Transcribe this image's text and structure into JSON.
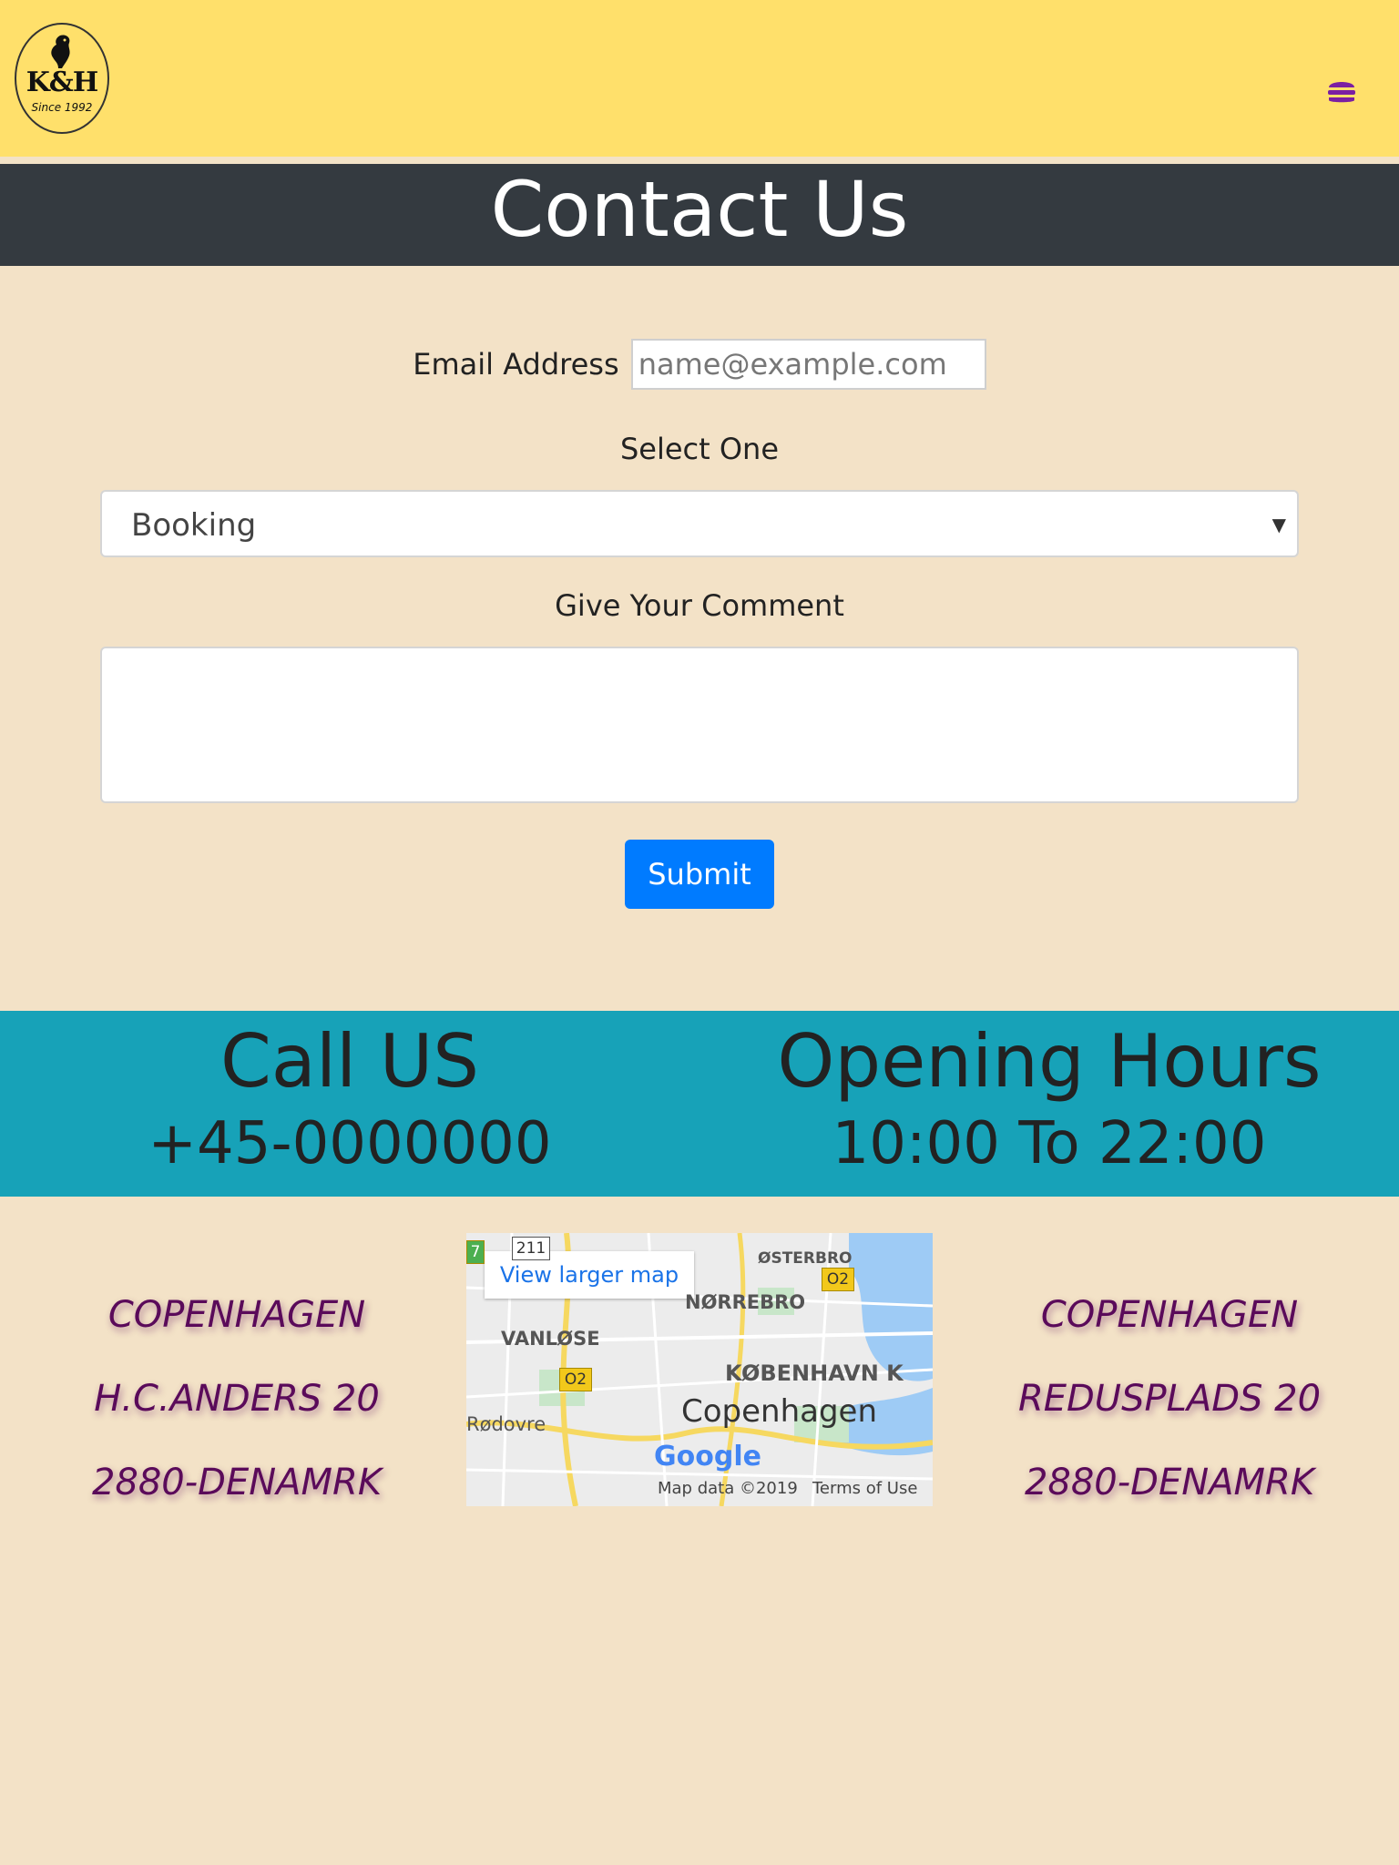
{
  "header": {
    "logo_text": "K&H",
    "logo_since": "Since 1992",
    "menu_icon": "burger-icon",
    "accent_color": "#ffe06b",
    "menu_icon_color": "#7b1fa2"
  },
  "page_title": "Contact Us",
  "form": {
    "email_label": "Email Address",
    "email_placeholder": "name@example.com",
    "select_label": "Select One",
    "select_value": "Booking",
    "comment_label": "Give Your Comment",
    "comment_value": "",
    "submit_label": "Submit",
    "submit_color": "#007bff"
  },
  "info": {
    "call_title": "Call US",
    "call_value": "+45-0000000",
    "hours_title": "Opening Hours",
    "hours_value": "10:00 To 22:00",
    "band_color": "#17a2b8"
  },
  "addresses": [
    {
      "city": "COPENHAGEN",
      "street": "H.C.ANDERS 20",
      "postal": "2880-DENAMRK"
    },
    {
      "city": "COPENHAGEN",
      "street": "REDUSPLADS 20",
      "postal": "2880-DENAMRK"
    }
  ],
  "map": {
    "view_larger": "View larger map",
    "labels": {
      "osterbro": "ØSTERBRO",
      "norrebro": "NØRREBRO",
      "vanlose": "VANLØSE",
      "kobenhavn": "KØBENHAVN K",
      "rodovre": "Rødovre",
      "city": "Copenhagen",
      "road_a": "O2",
      "road_b": "O2",
      "road_c": "211",
      "road_d": "7"
    },
    "google": "Google",
    "credit": "Map data ©2019",
    "terms": "Terms of Use"
  }
}
